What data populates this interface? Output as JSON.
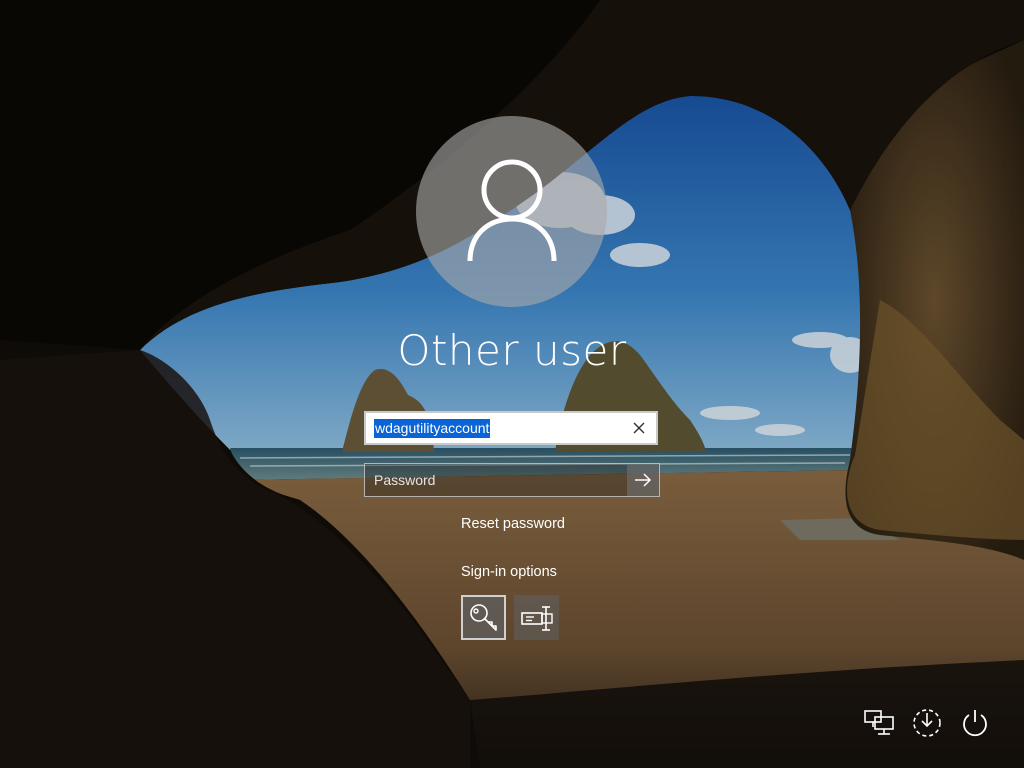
{
  "login": {
    "display_name": "Other user",
    "username_value": "wdagutilityaccount",
    "password_placeholder": "Password",
    "reset_password_label": "Reset password",
    "signin_options_label": "Sign-in options"
  },
  "signin_options": [
    {
      "name": "password",
      "icon": "key-icon"
    },
    {
      "name": "smart-card",
      "icon": "smart-card-icon"
    }
  ],
  "tray": [
    {
      "name": "network",
      "icon": "network-icon"
    },
    {
      "name": "ease-of-access",
      "icon": "ease-of-access-icon"
    },
    {
      "name": "power",
      "icon": "power-icon"
    }
  ],
  "colors": {
    "selection": "#0a64d6",
    "text": "#ffffff",
    "sky": "#1f5fa8"
  }
}
